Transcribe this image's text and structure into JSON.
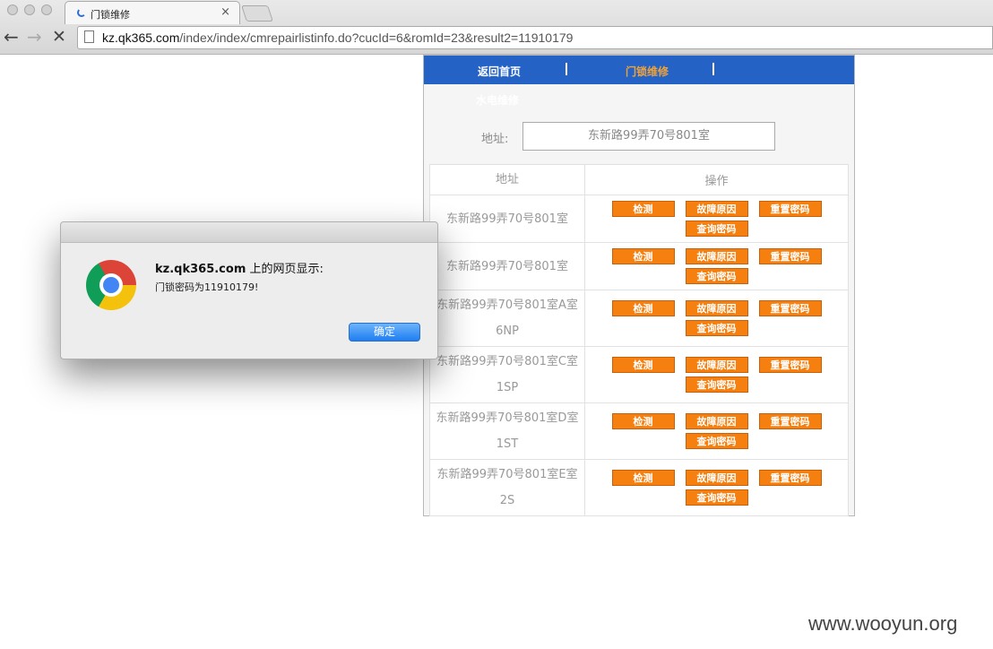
{
  "browser": {
    "tab_title": "门锁维修",
    "url_host": "kz.qk365.com",
    "url_path": "/index/index/cmrepairlistinfo.do?cucId=6&romId=23&result2=11910179"
  },
  "nav": {
    "home": "返回首页",
    "lock_repair": "门锁维修",
    "plumbing": "水电维修"
  },
  "address": {
    "label": "地址:",
    "value": "东新路99弄70号801室"
  },
  "table": {
    "headers": [
      "地址",
      "操作"
    ],
    "rows": [
      {
        "addr1": "东新路99弄70号801室",
        "addr2": ""
      },
      {
        "addr1": "东新路99弄70号801室",
        "addr2": ""
      },
      {
        "addr1": "东新路99弄70号801室A室",
        "addr2": "6NP"
      },
      {
        "addr1": "东新路99弄70号801室C室",
        "addr2": "1SP"
      },
      {
        "addr1": "东新路99弄70号801室D室",
        "addr2": "1ST"
      },
      {
        "addr1": "东新路99弄70号801室E室",
        "addr2": "2S"
      }
    ],
    "actions": {
      "detect": "检测",
      "fault": "故障原因",
      "reset": "重置密码",
      "query": "查询密码"
    }
  },
  "dialog": {
    "site": "kz.qk365.com",
    "title_suffix": " 上的网页显示:",
    "message": "门锁密码为11910179!",
    "ok": "确定"
  },
  "watermark": "www.wooyun.org",
  "colors": {
    "nav_bg": "#2463c5",
    "nav_active": "#f0a23a",
    "button_orange": "#f57f0f",
    "ok_blue": "#1f7ef2"
  }
}
